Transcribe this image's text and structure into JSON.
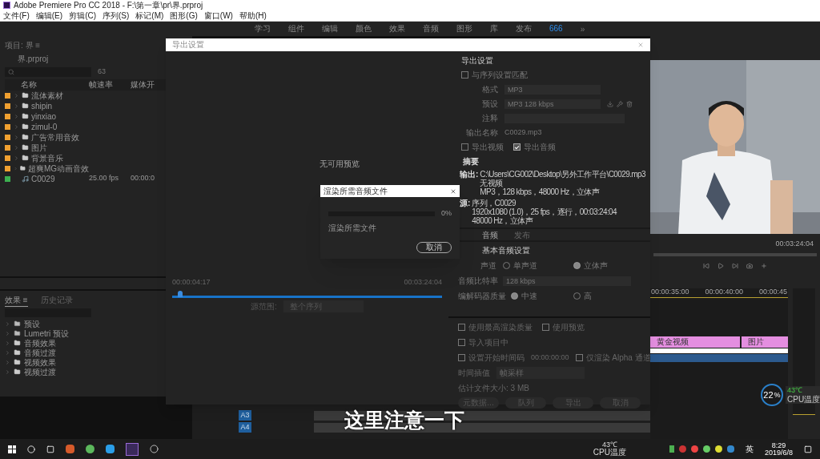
{
  "window": {
    "title": "Adobe Premiere Pro CC 2018 - F:\\第一章\\pr\\界.prproj"
  },
  "menu": [
    "文件(F)",
    "编辑(E)",
    "剪辑(C)",
    "序列(S)",
    "标记(M)",
    "图形(G)",
    "窗口(W)",
    "帮助(H)"
  ],
  "workspaces": [
    {
      "label": "学习",
      "selected": false
    },
    {
      "label": "组件",
      "selected": false
    },
    {
      "label": "编辑",
      "selected": false
    },
    {
      "label": "颜色",
      "selected": false
    },
    {
      "label": "效果",
      "selected": false
    },
    {
      "label": "音频",
      "selected": false
    },
    {
      "label": "图形",
      "selected": false
    },
    {
      "label": "库",
      "selected": false
    },
    {
      "label": "发布",
      "selected": false
    },
    {
      "label": "666",
      "selected": true
    }
  ],
  "workspace_more": "»",
  "project_panel": {
    "tab": "项目: 界 ≡",
    "file": "界.prproj",
    "count": "63",
    "columns": [
      "名称",
      "帧速率",
      "媒体开"
    ],
    "items": [
      {
        "name": "流体素材",
        "kind": "bin",
        "color": "#f0a030"
      },
      {
        "name": "shipin",
        "kind": "bin",
        "color": "#f0a030"
      },
      {
        "name": "yinxiao",
        "kind": "bin",
        "color": "#f0a030"
      },
      {
        "name": "zimul-0",
        "kind": "bin",
        "color": "#f0a030"
      },
      {
        "name": "广告常用音效",
        "kind": "bin",
        "color": "#f0a030"
      },
      {
        "name": "图片",
        "kind": "bin",
        "color": "#f0a030"
      },
      {
        "name": "背景音乐",
        "kind": "bin",
        "color": "#f0a030"
      },
      {
        "name": "超爽MG动画音效",
        "kind": "bin",
        "color": "#f0a030"
      },
      {
        "name": "C0029",
        "kind": "sequence",
        "color": "#3cb050",
        "frame_rate": "25.00 fps",
        "media_start": "00:00:0"
      }
    ]
  },
  "effects_panel": {
    "tabs": [
      {
        "label": "效果 ≡",
        "selected": true
      },
      {
        "label": "历史记录",
        "selected": false
      }
    ],
    "items": [
      {
        "name": "预设",
        "kind": "preset"
      },
      {
        "name": "Lumetri 预设",
        "kind": "preset"
      },
      {
        "name": "音频效果",
        "kind": "folder"
      },
      {
        "name": "音频过渡",
        "kind": "folder"
      },
      {
        "name": "视频效果",
        "kind": "folder"
      },
      {
        "name": "视频过渡",
        "kind": "folder"
      }
    ]
  },
  "export_dialog": {
    "title": "导出设置",
    "preview": {
      "message": "无可用预览",
      "in_time": "00:00:04:17",
      "out_time": "00:03:24:04",
      "level": 0.02,
      "range_label": "源范围:",
      "range_value": "整个序列"
    },
    "settings": {
      "heading": "导出设置",
      "match_sequence": {
        "label": "与序列设置匹配",
        "checked": false
      },
      "fields": [
        {
          "label": "格式",
          "value": "MP3",
          "kind": "dropdown"
        },
        {
          "label": "预设",
          "value": "MP3 128 kbps",
          "kind": "dropdown"
        },
        {
          "label": "注释",
          "kind": "input"
        },
        {
          "label": "输出名称",
          "value": "C0029.mp3",
          "kind": "text"
        }
      ],
      "export_toggles": [
        {
          "label": "导出视频",
          "checked": false
        },
        {
          "label": "导出音频",
          "checked": true
        }
      ],
      "summary_heading": "摘要",
      "summary": [
        {
          "label": "输出:",
          "lines": [
            "C:\\Users\\CG002\\Desktop\\另外工作平台\\C0029.mp3",
            "无视频",
            "MP3，128 kbps，48000 Hz，立体声"
          ]
        },
        {
          "label": "源:",
          "lines": [
            "序列，C0029",
            "1920x1080 (1.0)，25 fps，逐行，00:03:24:04",
            "48000 Hz，立体声"
          ]
        }
      ]
    },
    "tabs": [
      {
        "label": "音频",
        "selected": true
      },
      {
        "label": "发布",
        "selected": false
      }
    ],
    "audio": {
      "heading": "基本音频设置",
      "channels": {
        "label": "声道",
        "options": [
          {
            "label": "单声道",
            "selected": false
          },
          {
            "label": "立体声",
            "selected": true
          }
        ]
      },
      "bitrate": {
        "label": "音频比特率",
        "value": "128 kbps"
      },
      "quality": {
        "label": "编解码器质量",
        "options": [
          {
            "label": "中速",
            "selected": true
          },
          {
            "label": "高",
            "selected": false
          }
        ]
      }
    },
    "options": [
      {
        "label": "使用最高渲染质量",
        "checked": false
      },
      {
        "label": "使用预览",
        "checked": false
      },
      {
        "label": "导入项目中",
        "checked": false
      },
      {
        "label": "设置开始时间码",
        "checked": false,
        "value": "00:00:00:00"
      },
      {
        "label": "仅渲染 Alpha 通道",
        "checked": false
      }
    ],
    "interpolation": {
      "label": "时间插值",
      "value": "帧采样"
    },
    "file_size": "估计文件大小: 3 MB",
    "buttons": [
      "元数据...",
      "队列",
      "导出",
      "取消"
    ]
  },
  "progress_dialog": {
    "title": "渲染所需音频文件",
    "level": 0,
    "percent": "0%",
    "status": "渲染所需文件",
    "button": "取消"
  },
  "program_monitor": {
    "timecode": "00:03:24:04"
  },
  "timeline": {
    "ruler": [
      "00:00:35:00",
      "00:00:40:00",
      "00:00:45"
    ],
    "clips": [
      {
        "label": "黄金视频",
        "color": "#e48ee0"
      },
      {
        "label": "图片",
        "color": "#e48ee0"
      }
    ],
    "tracks": [
      "A3",
      "A4"
    ]
  },
  "cpu_widget": {
    "usage": "22",
    "unit": "%",
    "temperature": "43℃",
    "label": "CPU温度"
  },
  "subtitle": "这里注意一下",
  "taskbar": {
    "temperature": "43℃",
    "temperature_label": "CPU温度",
    "language": "英",
    "time": "8:29",
    "date": "2019/6/8"
  }
}
